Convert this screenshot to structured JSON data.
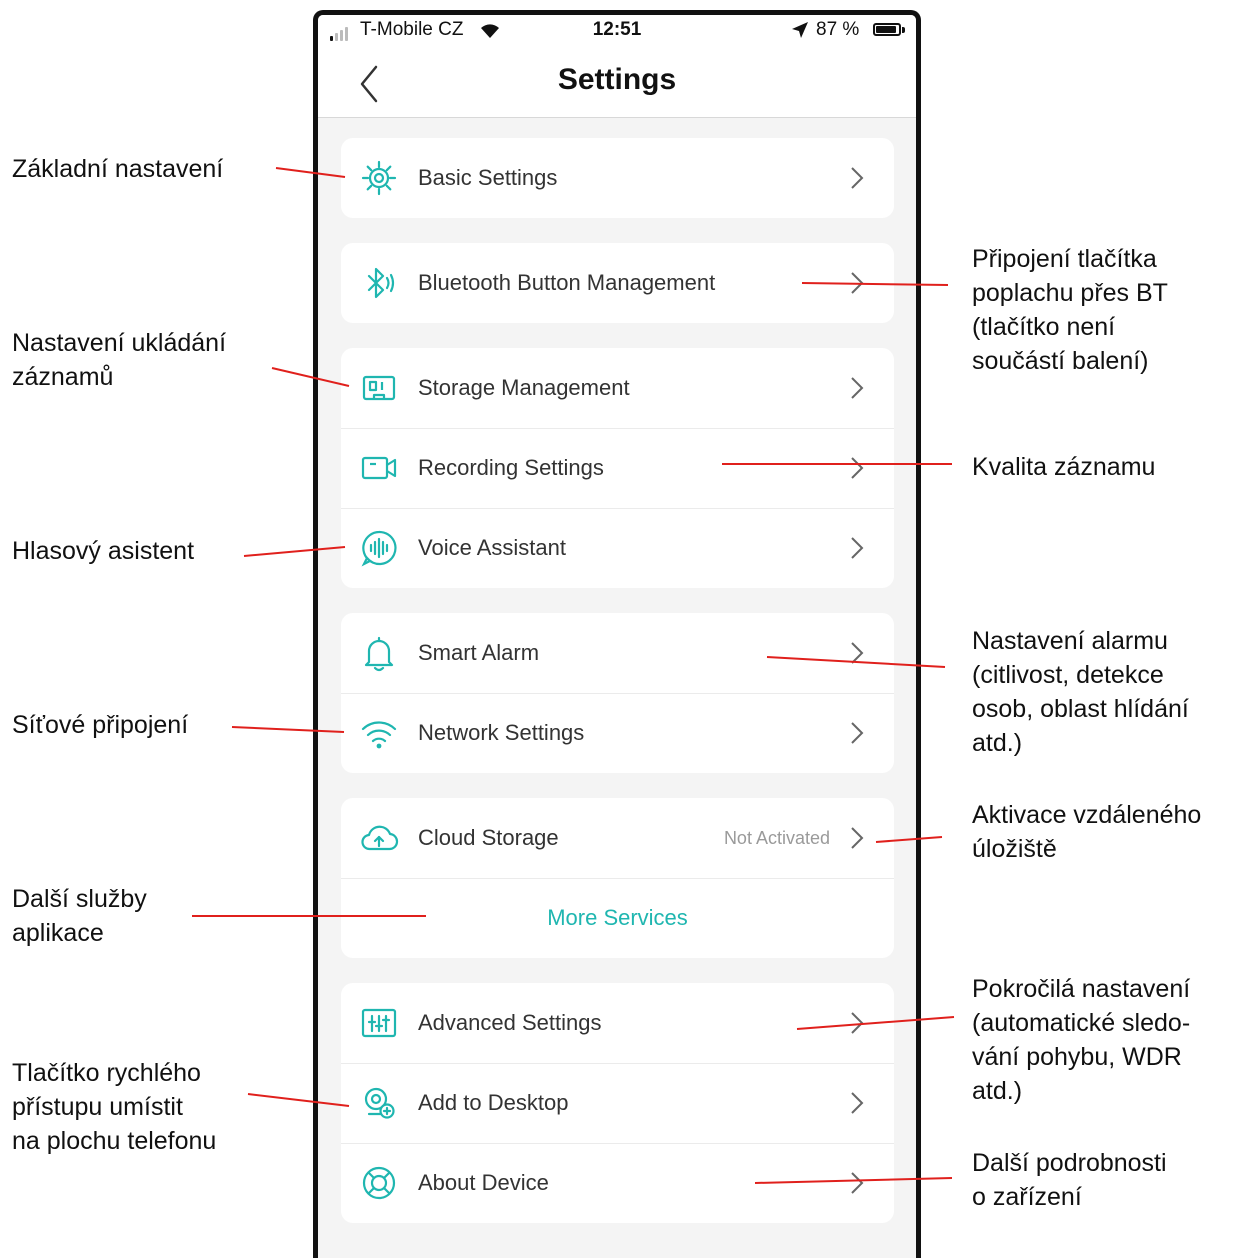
{
  "status_bar": {
    "carrier": "T-Mobile CZ",
    "time": "12:51",
    "battery": "87 %"
  },
  "nav": {
    "title": "Settings"
  },
  "settings": {
    "basic": "Basic Settings",
    "bluetooth": "Bluetooth Button Management",
    "storage": "Storage Management",
    "recording": "Recording Settings",
    "voice": "Voice Assistant",
    "smart_alarm": "Smart Alarm",
    "network": "Network Settings",
    "cloud": "Cloud Storage",
    "cloud_status": "Not Activated",
    "more_services": "More Services",
    "advanced": "Advanced Settings",
    "add_desktop": "Add to Desktop",
    "about": "About Device"
  },
  "annotations": {
    "basic": "Základní nastavení",
    "storage": "Nastavení ukládání\nzáznamů",
    "voice": "Hlasový asistent",
    "network": "Síťové připojení",
    "more_services": "Další služby\naplikace",
    "add_desktop": "Tlačítko rychlého\npřístupu umístit\nna plochu telefonu",
    "bluetooth": "Připojení tlačítka\npoplachu přes BT\n(tlačítko není\nsoučástí balení)",
    "recording": "Kvalita záznamu",
    "smart_alarm": "Nastavení alarmu\n(citlivost, detekce\nosob, oblast hlídání\natd.)",
    "cloud": "Aktivace vzdáleného\núložiště",
    "advanced": "Pokročilá nastavení\n(automatické sledo-\nvání pohybu, WDR\natd.)",
    "about": "Další podrobnosti\no zařízení"
  },
  "colors": {
    "accent": "#1fb6b0",
    "annotation_line": "#e0201c",
    "background": "#f4f4f4"
  },
  "icons": {
    "basic": "gear-icon",
    "bluetooth": "bluetooth-icon",
    "storage": "sd-card-icon",
    "recording": "video-camera-icon",
    "voice": "voice-wave-icon",
    "smart_alarm": "bell-icon",
    "network": "wifi-icon",
    "cloud": "cloud-upload-icon",
    "advanced": "sliders-icon",
    "add_desktop": "add-shortcut-icon",
    "about": "lifebuoy-icon"
  }
}
